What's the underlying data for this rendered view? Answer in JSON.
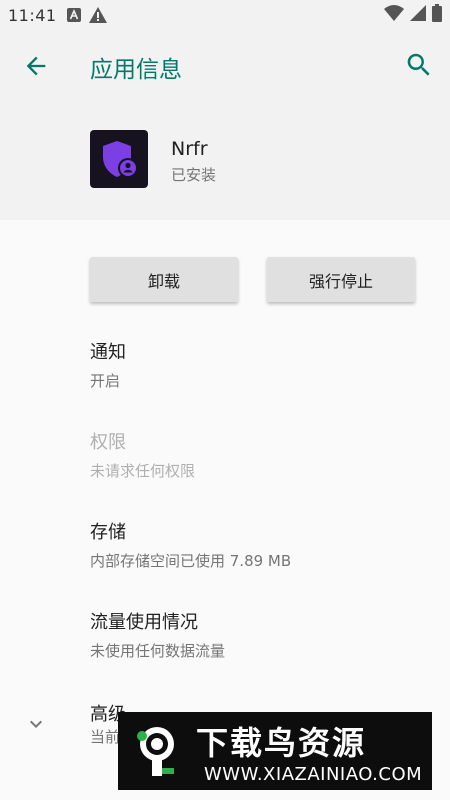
{
  "status_bar": {
    "time": "11:41"
  },
  "header": {
    "title": "应用信息"
  },
  "app": {
    "name": "Nrfr",
    "status": "已安装"
  },
  "buttons": {
    "uninstall": "卸载",
    "force_stop": "强行停止"
  },
  "settings": [
    {
      "title": "通知",
      "summary": "开启",
      "enabled": true
    },
    {
      "title": "权限",
      "summary": "未请求任何权限",
      "enabled": false
    },
    {
      "title": "存储",
      "summary": "内部存储空间已使用 7.89 MB",
      "enabled": true
    },
    {
      "title": "流量使用情况",
      "summary": "未使用任何数据流量",
      "enabled": true
    }
  ],
  "advanced": {
    "title": "高级",
    "summary": "当前"
  },
  "watermark": {
    "main": "下载鸟资源",
    "url": "WWW.XIAZAINIAO.COM"
  },
  "colors": {
    "accent": "#00796b",
    "app_icon_bg": "#17121f",
    "app_icon_fg": "#7b3fe4"
  }
}
